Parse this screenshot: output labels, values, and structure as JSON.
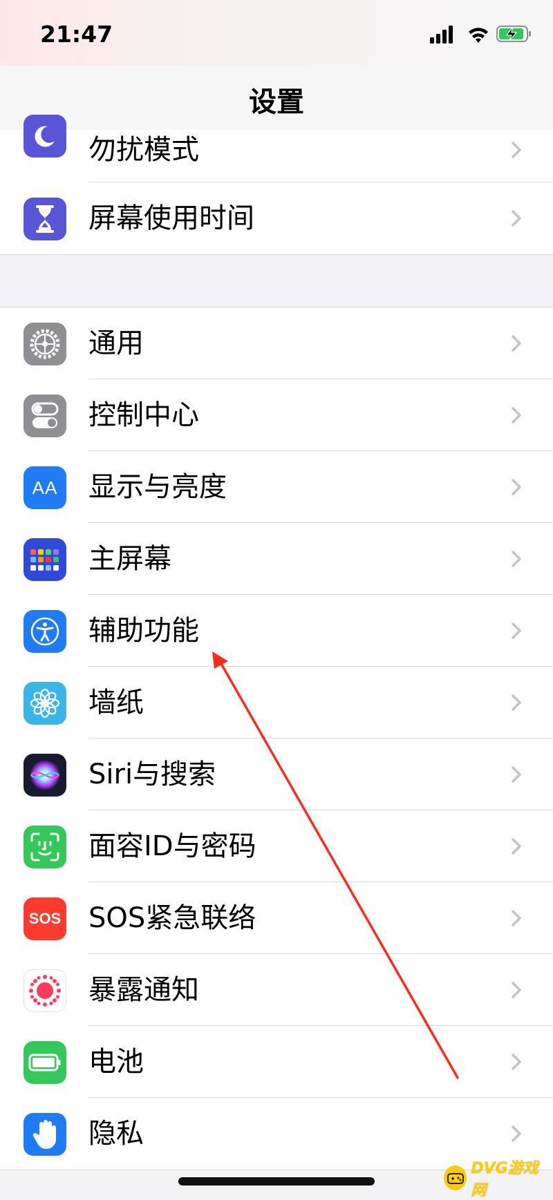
{
  "status_bar": {
    "time": "21:47"
  },
  "nav": {
    "title": "设置"
  },
  "top_group": [
    {
      "label": "勿扰模式",
      "icon": "moon-icon",
      "color": "#5856d6"
    },
    {
      "label": "屏幕使用时间",
      "icon": "hourglass-icon",
      "color": "#5856d6"
    }
  ],
  "main_group": [
    {
      "label": "通用",
      "icon": "gear-icon",
      "color": "#8e8e93"
    },
    {
      "label": "控制中心",
      "icon": "toggles-icon",
      "color": "#8e8e93"
    },
    {
      "label": "显示与亮度",
      "icon": "text-size-icon",
      "color": "#1f7cf6",
      "icon_text": "AA"
    },
    {
      "label": "主屏幕",
      "icon": "app-grid-icon",
      "color": "#2f4ad8"
    },
    {
      "label": "辅助功能",
      "icon": "accessibility-icon",
      "color": "#1f7cf6"
    },
    {
      "label": "墙纸",
      "icon": "flower-icon",
      "color": "#38b6e8"
    },
    {
      "label": "Siri与搜索",
      "icon": "siri-icon",
      "color": "#1a1a2e"
    },
    {
      "label": "面容ID与密码",
      "icon": "face-id-icon",
      "color": "#34c759"
    },
    {
      "label": "SOS紧急联络",
      "icon": "sos-icon",
      "color": "#ff3b30",
      "icon_text": "SOS"
    },
    {
      "label": "暴露通知",
      "icon": "exposure-icon",
      "color": "#ffffff"
    },
    {
      "label": "电池",
      "icon": "battery-icon",
      "color": "#34c759"
    },
    {
      "label": "隐私",
      "icon": "hand-icon",
      "color": "#1f7cf6"
    }
  ],
  "annotation": {
    "color": "#ff2a1a"
  },
  "watermark": {
    "text": "DVG游戏网"
  }
}
